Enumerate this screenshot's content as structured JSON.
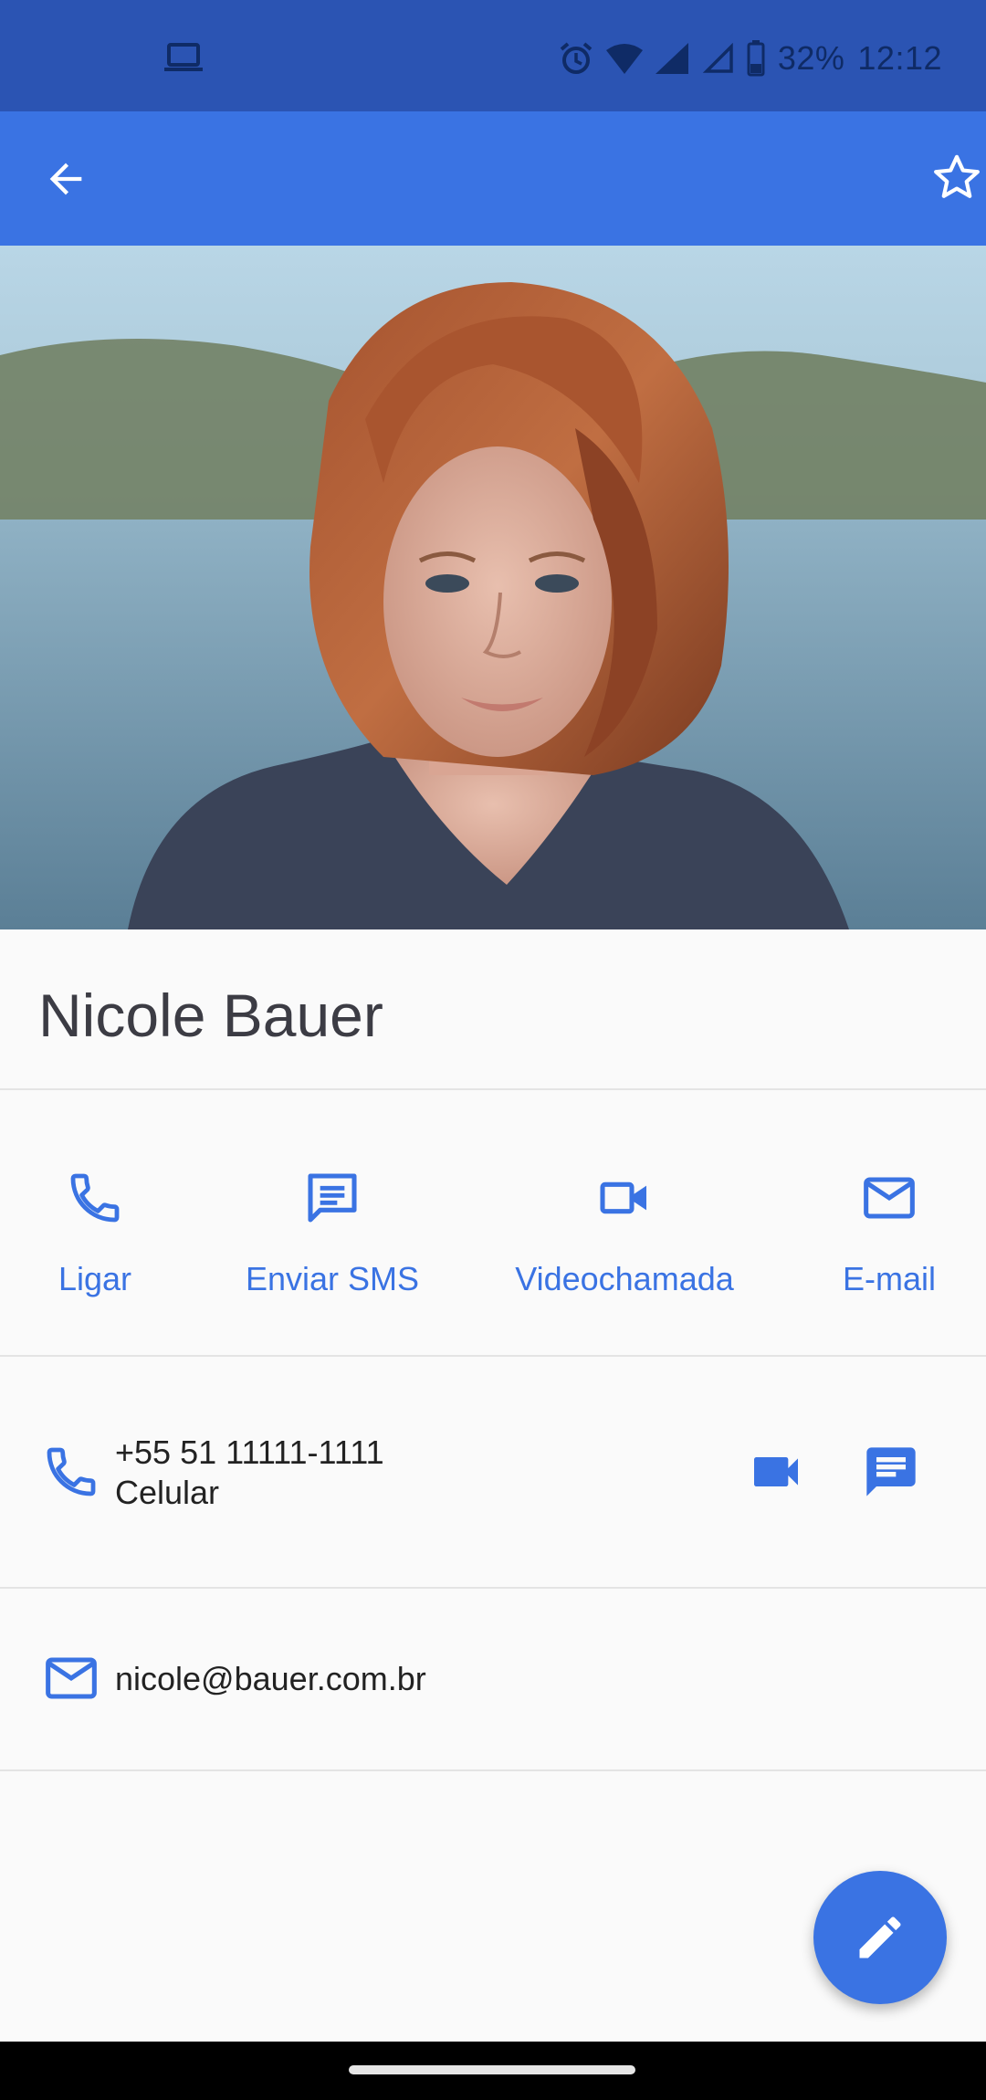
{
  "status_bar": {
    "battery": "32%",
    "time": "12:12",
    "icons": [
      "laptop-icon",
      "alarm-icon",
      "wifi-icon",
      "signal-icon",
      "signal-outline-icon",
      "battery-icon"
    ]
  },
  "app_bar": {
    "back_icon": "arrow-back-icon",
    "favorite_icon": "star-outline-icon"
  },
  "contact": {
    "name": "Nicole Bauer"
  },
  "actions": [
    {
      "label": "Ligar",
      "icon": "phone-icon"
    },
    {
      "label": "Enviar SMS",
      "icon": "message-icon"
    },
    {
      "label": "Videochamada",
      "icon": "videocam-icon"
    },
    {
      "label": "E-mail",
      "icon": "mail-icon"
    }
  ],
  "phone": {
    "number": "+55 51 11111-1111",
    "type": "Celular"
  },
  "email": {
    "address": "nicole@bauer.com.br"
  },
  "fab": {
    "icon": "edit-pencil-icon"
  },
  "colors": {
    "status_bar": "#2b54b3",
    "app_bar": "#3a73e3",
    "accent": "#3a73e3",
    "background": "#fafafa"
  }
}
